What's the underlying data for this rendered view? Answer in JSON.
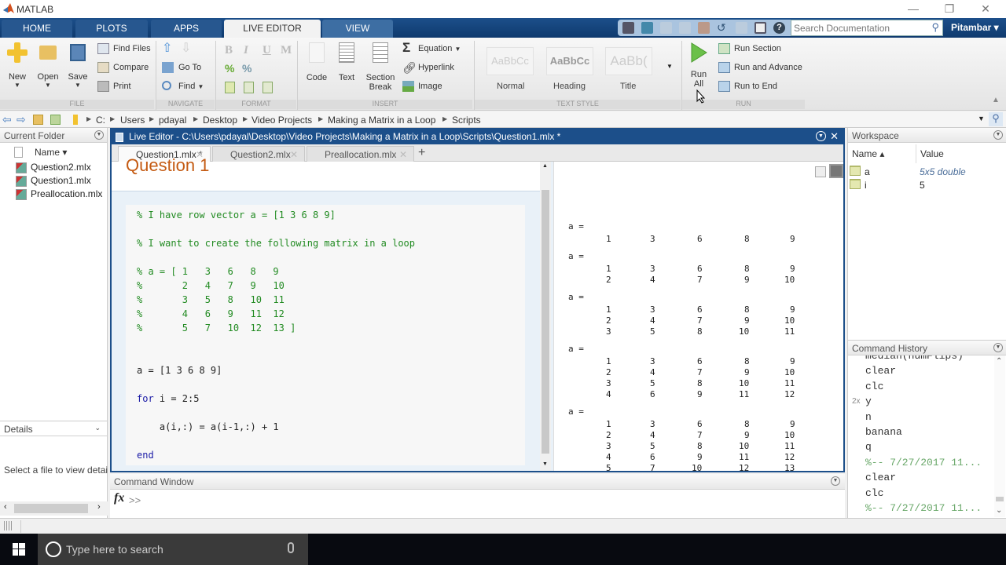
{
  "window": {
    "title": "MATLAB",
    "controls": [
      "—",
      "❐",
      "✕"
    ]
  },
  "ribbon_tabs": [
    {
      "label": "HOME",
      "active": false
    },
    {
      "label": "PLOTS",
      "active": false
    },
    {
      "label": "APPS",
      "active": false
    },
    {
      "label": "LIVE EDITOR",
      "active": true
    },
    {
      "label": "VIEW",
      "active": false
    }
  ],
  "quick_access": [
    "new-icon",
    "save-icon",
    "cut-icon",
    "copy-icon",
    "paste-icon",
    "undo-icon",
    "redo-icon",
    "switch-windows-icon",
    "help-icon"
  ],
  "search": {
    "placeholder": "Search Documentation"
  },
  "user": {
    "name": "Pitambar ▾"
  },
  "ribbon": {
    "file": {
      "label": "FILE",
      "new": "New",
      "open": "Open",
      "save": "Save",
      "find_files": "Find Files",
      "compare": "Compare",
      "print": "Print"
    },
    "navigate": {
      "label": "NAVIGATE",
      "go_to": "Go To",
      "find": "Find"
    },
    "format": {
      "label": "FORMAT",
      "bold": "B",
      "italic": "I",
      "underline": "U",
      "mono": "M"
    },
    "insert": {
      "label": "INSERT",
      "code": "Code",
      "text": "Text",
      "section_break_1": "Section",
      "section_break_2": "Break",
      "equation": "Equation",
      "hyperlink": "Hyperlink",
      "image": "Image"
    },
    "text_style": {
      "label": "TEXT STYLE",
      "styles": [
        {
          "sample": "AaBbCc",
          "name": "Normal"
        },
        {
          "sample": "AaBbCc",
          "name": "Heading"
        },
        {
          "sample": "AaBb(",
          "name": "Title"
        }
      ]
    },
    "run": {
      "label": "RUN",
      "run_all_1": "Run",
      "run_all_2": "All",
      "run_section": "Run Section",
      "run_and_advance": "Run and Advance",
      "run_to_end": "Run to End"
    }
  },
  "address": {
    "crumbs": [
      "C:",
      "Users",
      "pdayal",
      "Desktop",
      "Video Projects",
      "Making a Matrix in a Loop",
      "Scripts"
    ]
  },
  "current_folder": {
    "title": "Current Folder",
    "column": "Name ▾",
    "files": [
      "Question2.mlx",
      "Question1.mlx",
      "Preallocation.mlx"
    ]
  },
  "details": {
    "title": "Details",
    "message": "Select a file to view details"
  },
  "editor": {
    "title": "Live Editor - C:\\Users\\pdayal\\Desktop\\Video Projects\\Making a Matrix in a Loop\\Scripts\\Question1.mlx *",
    "tabs": [
      {
        "label": "Question1.mlx *",
        "active": true
      },
      {
        "label": "Question2.mlx",
        "active": false
      },
      {
        "label": "Preallocation.mlx",
        "active": false
      }
    ],
    "add_tab": "+",
    "heading": "Question 1",
    "code": [
      {
        "text": "% I have row vector a = [1 3 6 8 9]",
        "type": "cmt"
      },
      {
        "text": "% I want to create the following matrix in a loop",
        "type": "cmt"
      },
      {
        "text": "% a = [ 1   3   6   8   9",
        "type": "cmt"
      },
      {
        "text": "%       2   4   7   9   10",
        "type": "cmt"
      },
      {
        "text": "%       3   5   8   10  11",
        "type": "cmt"
      },
      {
        "text": "%       4   6   9   11  12",
        "type": "cmt"
      },
      {
        "text": "%       5   7   10  12  13 ]",
        "type": "cmt"
      },
      {
        "text": "a = [1 3 6 8 9]",
        "type": "code"
      },
      {
        "text": "for i = 2:5",
        "type": "kwline",
        "kw": "for",
        "rest": " i = 2:5"
      },
      {
        "text": "    a(i,:) = a(i-1,:) + 1",
        "type": "code"
      },
      {
        "text": "end",
        "type": "kw"
      }
    ],
    "output": [
      {
        "label": "a =",
        "rows": [
          [
            1,
            3,
            6,
            8,
            9
          ]
        ]
      },
      {
        "label": "a =",
        "rows": [
          [
            1,
            3,
            6,
            8,
            9
          ],
          [
            2,
            4,
            7,
            9,
            10
          ]
        ]
      },
      {
        "label": "a =",
        "rows": [
          [
            1,
            3,
            6,
            8,
            9
          ],
          [
            2,
            4,
            7,
            9,
            10
          ],
          [
            3,
            5,
            8,
            10,
            11
          ]
        ]
      },
      {
        "label": "a =",
        "rows": [
          [
            1,
            3,
            6,
            8,
            9
          ],
          [
            2,
            4,
            7,
            9,
            10
          ],
          [
            3,
            5,
            8,
            10,
            11
          ],
          [
            4,
            6,
            9,
            11,
            12
          ]
        ]
      },
      {
        "label": "a =",
        "rows": [
          [
            1,
            3,
            6,
            8,
            9
          ],
          [
            2,
            4,
            7,
            9,
            10
          ],
          [
            3,
            5,
            8,
            10,
            11
          ],
          [
            4,
            6,
            9,
            11,
            12
          ],
          [
            5,
            7,
            10,
            12,
            13
          ]
        ]
      }
    ]
  },
  "command_window": {
    "title": "Command Window",
    "fx": "fx",
    "prompt": ">>"
  },
  "workspace": {
    "title": "Workspace",
    "columns": [
      "Name ▴",
      "Value"
    ],
    "vars": [
      {
        "name": "a",
        "value": "5x5 double"
      },
      {
        "name": "i",
        "value": "5"
      }
    ]
  },
  "command_history": {
    "title": "Command History",
    "items": [
      {
        "count": "",
        "text": "median(numFlips)",
        "comment": false
      },
      {
        "count": "",
        "text": "clear",
        "comment": false
      },
      {
        "count": "",
        "text": "clc",
        "comment": false
      },
      {
        "count": "2x",
        "text": "y",
        "comment": false
      },
      {
        "count": "",
        "text": "n",
        "comment": false
      },
      {
        "count": "",
        "text": "banana",
        "comment": false
      },
      {
        "count": "",
        "text": "q",
        "comment": false
      },
      {
        "count": "",
        "text": "%-- 7/27/2017 11...",
        "comment": true
      },
      {
        "count": "",
        "text": "clear",
        "comment": false
      },
      {
        "count": "",
        "text": "clc",
        "comment": false
      },
      {
        "count": "",
        "text": "%-- 7/27/2017 11...",
        "comment": true
      }
    ]
  },
  "taskbar": {
    "search_placeholder": "Type here to search"
  },
  "colors": {
    "brand_blue": "#1c4f8a",
    "comment_green": "#228b22",
    "keyword_blue": "#1a1aa6",
    "heading_orange": "#c45a12"
  }
}
